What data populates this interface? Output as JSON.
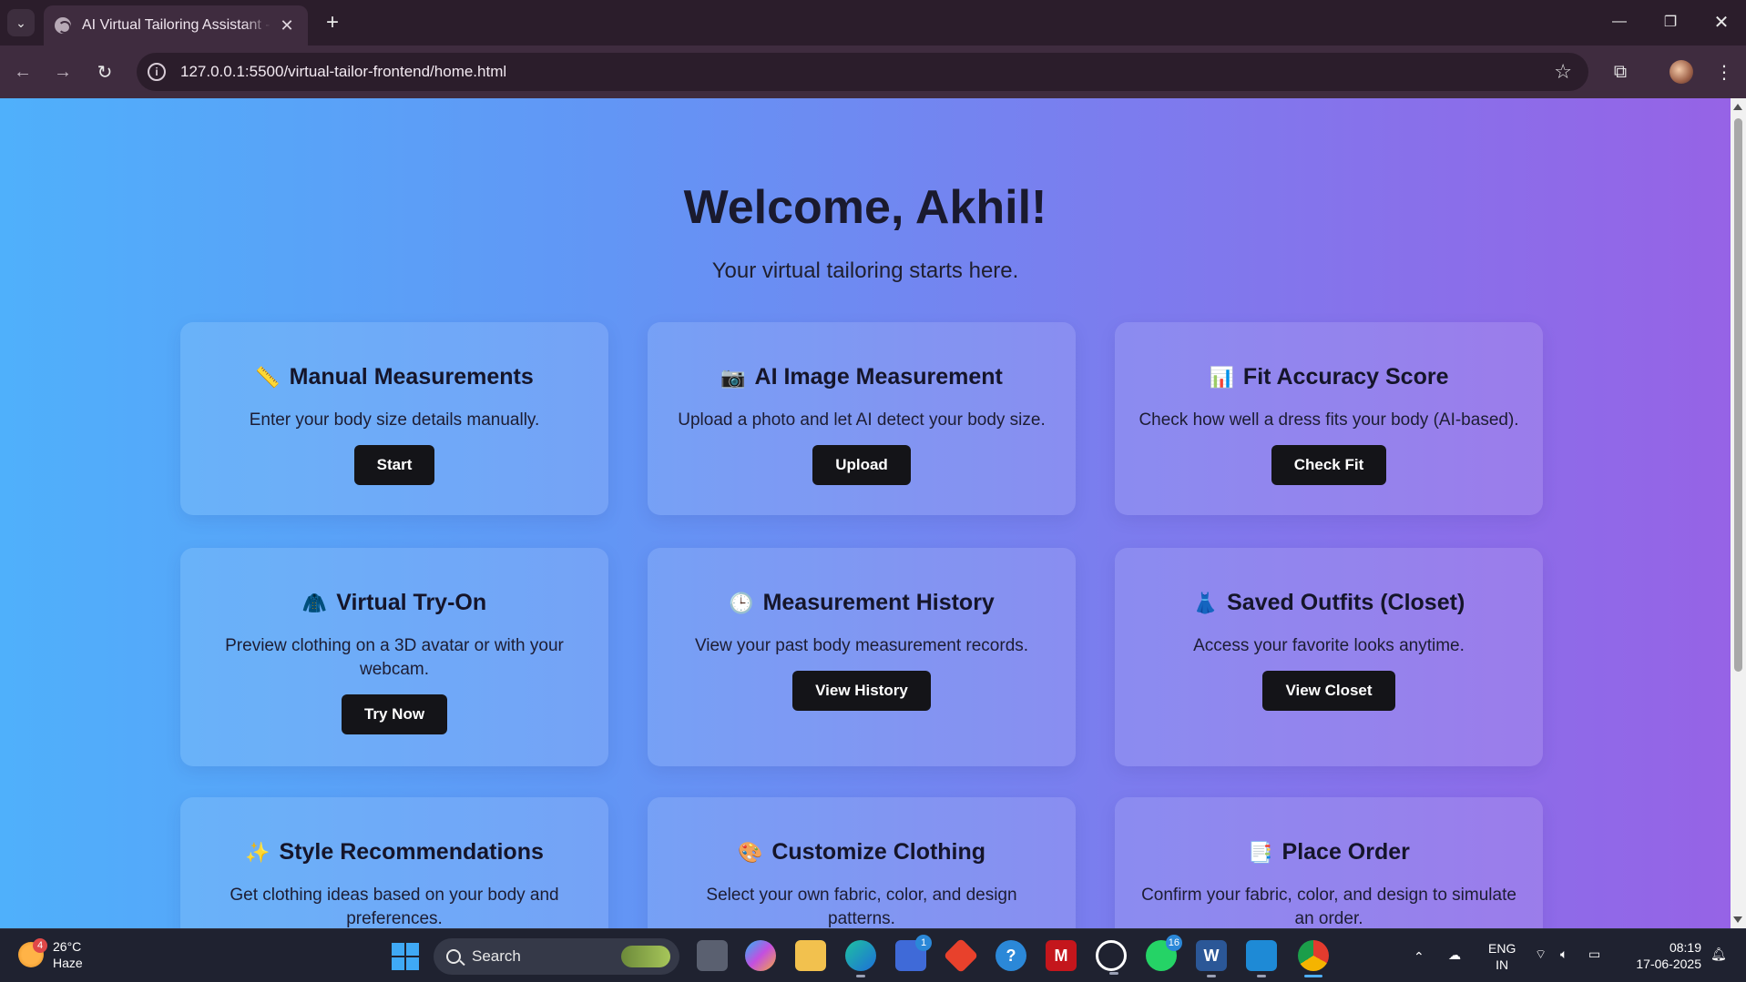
{
  "browser": {
    "tab_title": "AI Virtual Tailoring Assistant - H",
    "url": "127.0.0.1:5500/virtual-tailor-frontend/home.html"
  },
  "page": {
    "welcome": "Welcome, Akhil!",
    "subtitle": "Your virtual tailoring starts here.",
    "cards": [
      {
        "icon": "📏",
        "title": "Manual Measurements",
        "desc": "Enter your body size details manually.",
        "button": "Start"
      },
      {
        "icon": "📷",
        "title": "AI Image Measurement",
        "desc": "Upload a photo and let AI detect your body size.",
        "button": "Upload"
      },
      {
        "icon": "📊",
        "title": "Fit Accuracy Score",
        "desc": "Check how well a dress fits your body (AI-based).",
        "button": "Check Fit"
      },
      {
        "icon": "🧥",
        "title": "Virtual Try-On",
        "desc": "Preview clothing on a 3D avatar or with your webcam.",
        "button": "Try Now"
      },
      {
        "icon": "🕒",
        "title": "Measurement History",
        "desc": "View your past body measurement records.",
        "button": "View History"
      },
      {
        "icon": "👗",
        "title": "Saved Outfits (Closet)",
        "desc": "Access your favorite looks anytime.",
        "button": "View Closet"
      },
      {
        "icon": "✨",
        "title": "Style Recommendations",
        "desc": "Get clothing ideas based on your body and preferences.",
        "button": ""
      },
      {
        "icon": "🎨",
        "title": "Customize Clothing",
        "desc": "Select your own fabric, color, and design patterns.",
        "button": ""
      },
      {
        "icon": "📑",
        "title": "Place Order",
        "desc": "Confirm your fabric, color, and design to simulate an order.",
        "button": ""
      }
    ]
  },
  "taskbar": {
    "weather_temp": "26°C",
    "weather_desc": "Haze",
    "weather_badge": "4",
    "search_label": "Search",
    "store_badge": "1",
    "whatsapp_badge": "16",
    "lang_top": "ENG",
    "lang_bottom": "IN",
    "time": "08:19",
    "date": "17-06-2025"
  }
}
